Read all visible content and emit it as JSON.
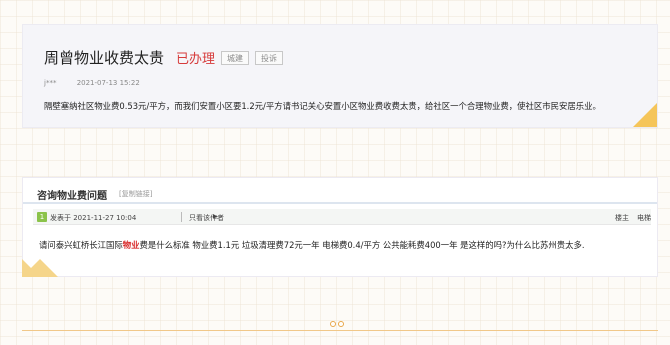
{
  "card1": {
    "title": "周曾物业收费太贵",
    "status": "已办理",
    "tag_build": "城建",
    "tag_complaint": "投诉",
    "user": "j***",
    "date": "2021-07-13 15:22",
    "body": "隔壁塞纳社区物业费0.53元/平方，而我们安置小区要1.2元/平方请书记关心安置小区物业费收费太贵，给社区一个合理物业费，使社区市民安居乐业。"
  },
  "card2": {
    "header_title": "咨询物业费问题",
    "copy_link": "[复制链接]",
    "avatar": "1",
    "posted": "发表于 2021-11-27 10:04",
    "only_author": "只看该作者",
    "play_icon": "▶",
    "floor": "楼主",
    "elevator": "电梯",
    "content_pre": "请问泰兴虹桥长江国际",
    "content_hl": "物业",
    "content_post": "费是什么标准    物业费1.1元     垃圾清理费72元一年    电梯费0.4/平方     公共能耗费400一年   是这样的吗?为什么比苏州贵太多."
  },
  "colors": {
    "status_red": "#d63b3b",
    "highlight_red": "#d82a2a",
    "accent_gold": "#f5c55a"
  }
}
